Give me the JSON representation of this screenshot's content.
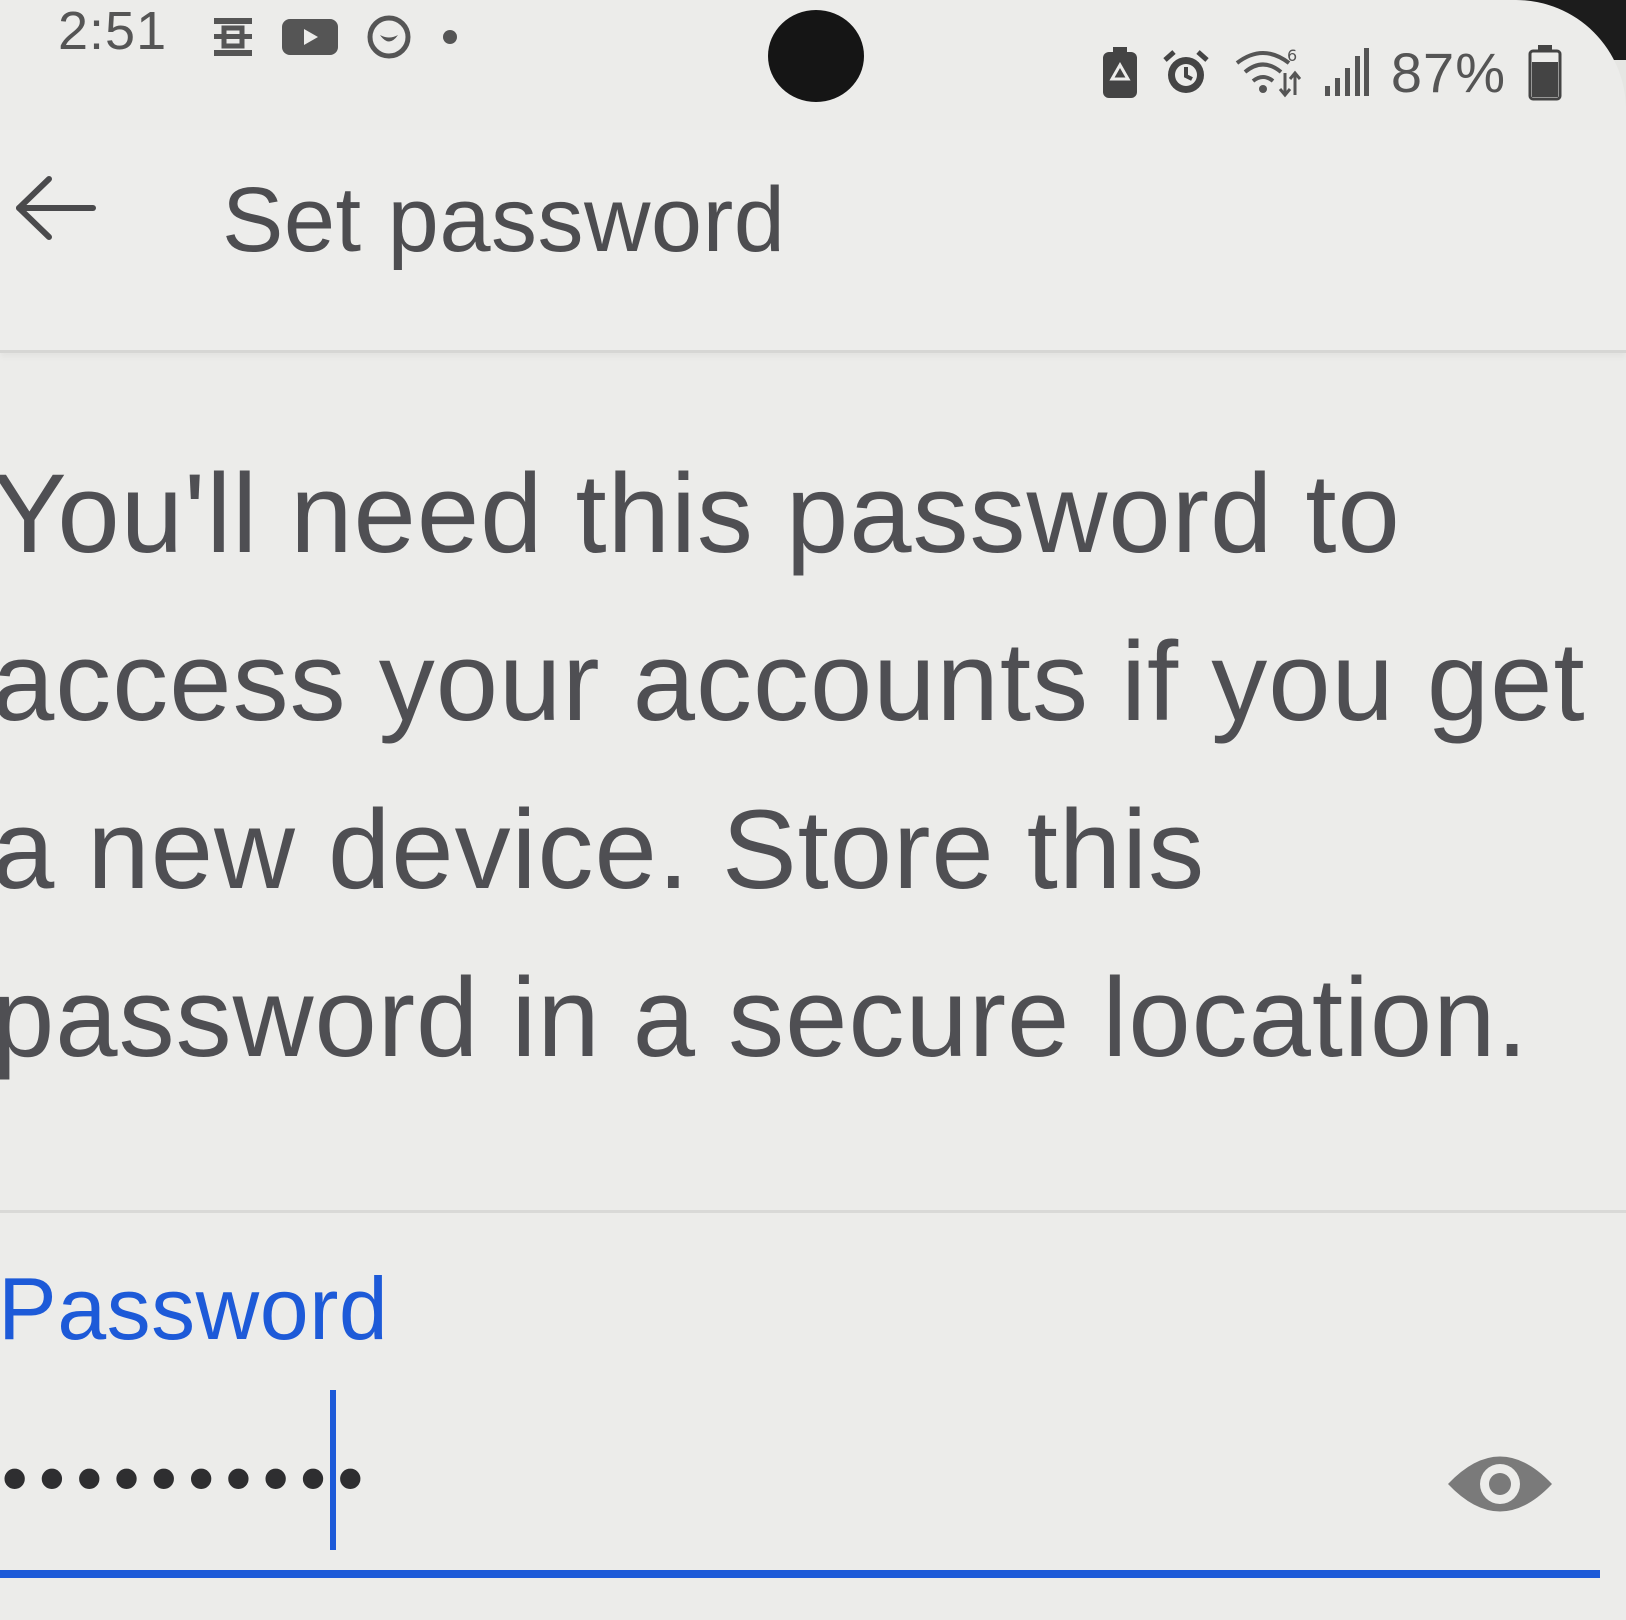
{
  "status_bar": {
    "time": "2:51",
    "left_icons": [
      "qr-scan-icon",
      "youtube-icon",
      "notification-circle-icon",
      "dot-icon"
    ],
    "right_icons": [
      "battery-saver-icon",
      "alarm-icon",
      "wifi-6-icon",
      "signal-icon"
    ],
    "battery_percent": "87%",
    "battery_level": 0.87
  },
  "app_bar": {
    "back_icon": "arrow-left-icon",
    "title": "Set password"
  },
  "description": "You'll need this password to access your accounts if you get a new device. Store this password in a secure location.",
  "password_field": {
    "label": "Password",
    "masked_value": "••••••••••",
    "toggle_icon": "eye-icon"
  },
  "colors": {
    "accent": "#1d5ad8",
    "text": "#4f4f53",
    "background": "#ececea"
  }
}
